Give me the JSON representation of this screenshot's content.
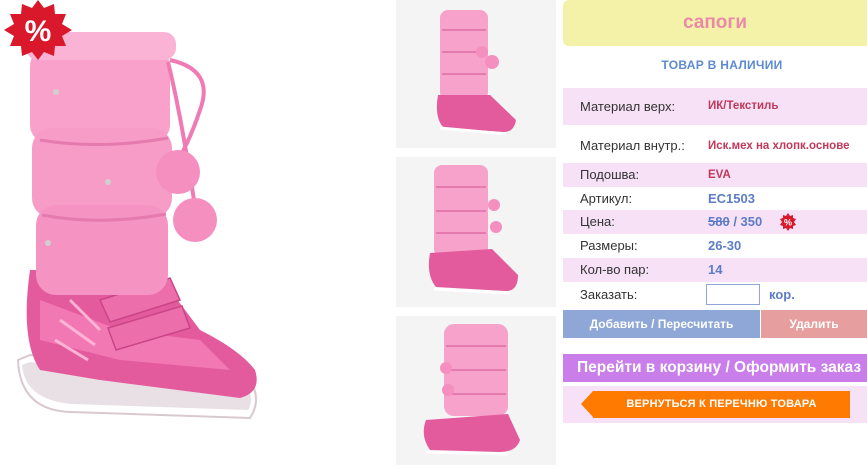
{
  "product": {
    "title": "сапоги",
    "stock_status": "ТОВАР В НАЛИЧИИ",
    "sale_badge_symbol": "%",
    "price_badge_symbol": "%"
  },
  "specs": {
    "material_top_label": "Материал верх:",
    "material_top_value": "ИК/Текстиль",
    "material_inner_label": "Материал внутр.:",
    "material_inner_value": "Иск.мех на хлопк.основе",
    "sole_label": "Подошва:",
    "sole_value": "EVA",
    "article_label": "Артикул:",
    "article_value": "EC1503",
    "price_label": "Цена:",
    "price_old": "580",
    "price_separator": " / ",
    "price_new": "350",
    "sizes_label": "Размеры:",
    "sizes_value": "26-30",
    "pairs_label": "Кол-во пар:",
    "pairs_value": "14",
    "order_label": "Заказать:",
    "order_value": "",
    "order_unit": "кор."
  },
  "actions": {
    "add_label": "Добавить / Пересчитать",
    "delete_label": "Удалить",
    "cart_label": "Перейти в корзину / Оформить заказ",
    "back_label": "ВЕРНУТЬСЯ К ПЕРЕЧНЮ ТОВАРА"
  },
  "colors": {
    "title_bg": "#f4f1a8",
    "title_text": "#e98aa8",
    "accent_blue": "#5d7cc7",
    "accent_red": "#c0395a",
    "row_highlight": "#f6e1f6",
    "add_button": "#8fa7d6",
    "delete_button": "#e79e9e",
    "cart_button": "#c97ee9",
    "back_button": "#ff7a00",
    "boot_pink": "#f58fbf"
  },
  "images": {
    "main_photo": "pink-winter-boot-photo",
    "thumbnails": [
      "boot-front-view-thumbnail",
      "boot-side-view-thumbnail",
      "boot-back-view-thumbnail"
    ]
  }
}
